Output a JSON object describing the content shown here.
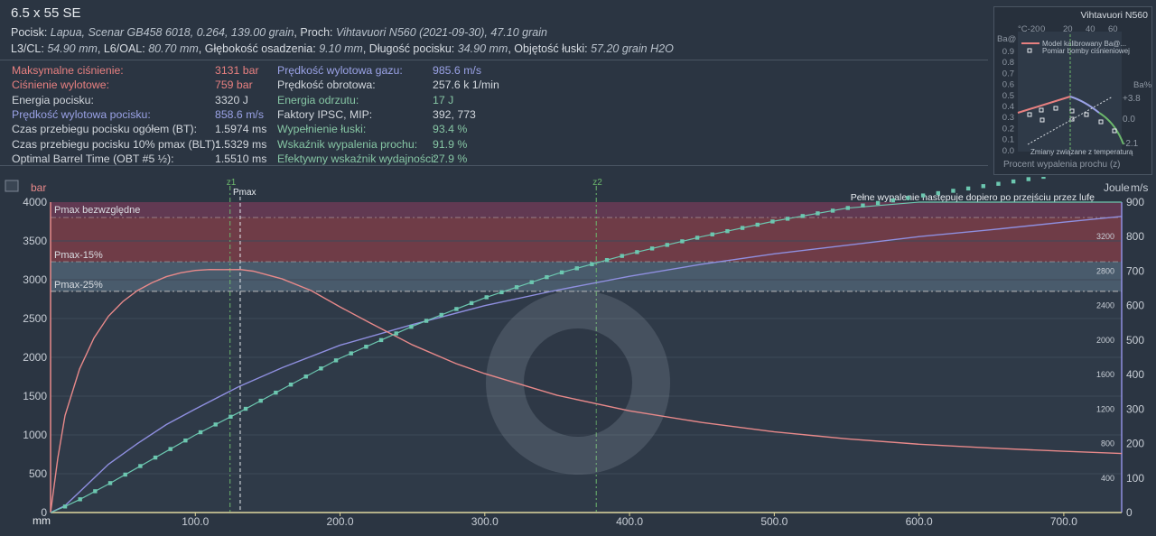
{
  "header": {
    "title": "6.5 x 55 SE",
    "line1": [
      {
        "t": "Pocisk: ",
        "i": false
      },
      {
        "t": "Lapua, Scenar GB458 6018, 0.264, 139.00 grain",
        "i": true
      },
      {
        "t": ", Proch: ",
        "i": false
      },
      {
        "t": "Vihtavuori N560 (2021-09-30), 47.10 grain",
        "i": true
      }
    ],
    "line2": [
      {
        "t": "L3/CL: ",
        "i": false
      },
      {
        "t": "54.90 mm",
        "i": true
      },
      {
        "t": ", L6/OAL: ",
        "i": false
      },
      {
        "t": "80.70 mm",
        "i": true
      },
      {
        "t": ", Głębokość osadzenia: ",
        "i": false
      },
      {
        "t": "9.10 mm",
        "i": true
      },
      {
        "t": ", Długość pocisku: ",
        "i": false
      },
      {
        "t": "34.90 mm",
        "i": true
      },
      {
        "t": ", Objętość łuski: ",
        "i": false
      },
      {
        "t": "57.20 grain H2O",
        "i": true
      }
    ]
  },
  "stats": {
    "col1": [
      {
        "label": "Maksymalne ciśnienie:",
        "value": "3131 bar",
        "color": "red"
      },
      {
        "label": "Ciśnienie wylotowe:",
        "value": "759 bar",
        "color": "red"
      },
      {
        "label": "Energia pocisku:",
        "value": "3320 J",
        "color": "norm"
      },
      {
        "label": "Prędkość wylotowa pocisku:",
        "value": "858.6 m/s",
        "color": "blue"
      },
      {
        "label": "Czas przebiegu pocisku ogółem (BT):",
        "value": "1.5974 ms",
        "color": "norm"
      },
      {
        "label": "Czas przebiegu pocisku 10% pmax (BLT):",
        "value": "1.5329 ms",
        "color": "norm"
      },
      {
        "label": "Optimal Barrel Time (OBT #5 ½):",
        "value": "1.5510 ms",
        "color": "norm"
      }
    ],
    "col2": [
      {
        "label": "Prędkość wylotowa gazu:",
        "value": "985.6 m/s",
        "color": "blue"
      },
      {
        "label": "Prędkość obrotowa:",
        "value": "257.6 k 1/min",
        "color": "norm"
      },
      {
        "label": "Energia odrzutu:",
        "value": "17 J",
        "color": "green"
      },
      {
        "label": "Faktory IPSC, MIP:",
        "value": "392, 773",
        "color": "norm"
      },
      {
        "label": "Wypełnienie łuski:",
        "value": "93.4 %",
        "color": "green"
      },
      {
        "label": "Wskaźnik wypalenia prochu:",
        "value": "91.9 %",
        "color": "green"
      },
      {
        "label": "Efektywny wskaźnik wydajności:",
        "value": "27.9 %",
        "color": "green"
      }
    ]
  },
  "colors": {
    "pressure": "#e8898a",
    "velocity": "#8f8fe0",
    "energy": "#6cc7b0",
    "bandTop": "#6a3a55",
    "bandMid": "#7a3d48",
    "bandLow": "#4e6173",
    "bg": "#2b3542"
  },
  "chart_data": {
    "type": "line",
    "xlabel": "mm",
    "ylabel": "bar",
    "ylabel2": "m/s",
    "ylabel3": "Joule",
    "xlim": [
      0,
      740
    ],
    "ylim": [
      0,
      4000
    ],
    "ylim2": [
      0,
      900
    ],
    "ylim3": [
      0,
      3600
    ],
    "xticks": [
      "100.0",
      "200.0",
      "300.0",
      "400.0",
      "500.0",
      "600.0",
      "700.0"
    ],
    "yticks": [
      "0",
      "500",
      "1000",
      "1500",
      "2000",
      "2500",
      "3000",
      "3500",
      "4000"
    ],
    "yticks2": [
      "0",
      "100",
      "200",
      "300",
      "400",
      "500",
      "600",
      "700",
      "800",
      "900"
    ],
    "yticks3": [
      "400",
      "800",
      "1200",
      "1600",
      "2000",
      "2400",
      "2800",
      "3200"
    ],
    "bands": [
      {
        "name": "Pmax bezwzględne",
        "from": 3800,
        "to": 4000
      },
      {
        "name": "Pmax-15%",
        "from": 3230,
        "to": 3800
      },
      {
        "name": "Pmax-25%",
        "from": 2850,
        "to": 3230
      }
    ],
    "markers": [
      {
        "name": "z1",
        "x": 124
      },
      {
        "name": "Pmax",
        "x": 131
      },
      {
        "name": "z2",
        "x": 377
      }
    ],
    "annotation": "Pełne wypalenie następuje dopiero po przejściu przez lufę",
    "series": [
      {
        "name": "pressure",
        "axis": "bar",
        "x": [
          0,
          5,
          10,
          20,
          30,
          40,
          50,
          60,
          70,
          80,
          90,
          100,
          110,
          120,
          131,
          140,
          160,
          180,
          200,
          220,
          250,
          280,
          300,
          350,
          400,
          450,
          500,
          550,
          600,
          650,
          700,
          740
        ],
        "values": [
          0,
          700,
          1250,
          1850,
          2250,
          2530,
          2720,
          2860,
          2960,
          3040,
          3090,
          3120,
          3131,
          3130,
          3131,
          3110,
          3010,
          2860,
          2650,
          2450,
          2160,
          1920,
          1790,
          1510,
          1310,
          1160,
          1040,
          950,
          880,
          830,
          790,
          760
        ]
      },
      {
        "name": "velocity",
        "axis": "m/s",
        "x": [
          0,
          10,
          20,
          40,
          60,
          80,
          100,
          130,
          160,
          200,
          250,
          300,
          350,
          400,
          450,
          500,
          550,
          600,
          650,
          700,
          740
        ],
        "values": [
          0,
          20,
          60,
          140,
          200,
          255,
          300,
          365,
          420,
          485,
          545,
          600,
          645,
          685,
          720,
          750,
          775,
          800,
          820,
          842,
          858.6
        ]
      },
      {
        "name": "energy",
        "axis": "Joule",
        "x": [
          0,
          10,
          20,
          40,
          60,
          80,
          100,
          130,
          160,
          200,
          250,
          300,
          350,
          400,
          450,
          500,
          550,
          600,
          650,
          700,
          740
        ],
        "values": [
          0,
          70,
          150,
          330,
          520,
          710,
          900,
          1160,
          1430,
          1790,
          2160,
          2490,
          2770,
          3000,
          3200,
          3380,
          3530,
          3670,
          3800,
          3930,
          4040
        ]
      }
    ]
  },
  "mini": {
    "title": "Vihtavuori N560",
    "legend1": "Model kalibrowany Ba@...",
    "legend2": "Pomiar bomby ciśnieniowej",
    "bottom": "Procent wypalenia prochu (z)",
    "note": "Zmiany związane z temperaturą",
    "yleft": [
      "0.9",
      "0.8",
      "0.7",
      "0.6",
      "0.5",
      "0.4",
      "0.3",
      "0.2",
      "0.1",
      "0.0"
    ],
    "ylabelLeft": "Ba@",
    "ylabelRight": "Ba%",
    "xtop": [
      "°C-20",
      "0",
      "20",
      "40",
      "60"
    ],
    "yright": [
      "+3.8",
      "0.0",
      "-2.1"
    ]
  }
}
